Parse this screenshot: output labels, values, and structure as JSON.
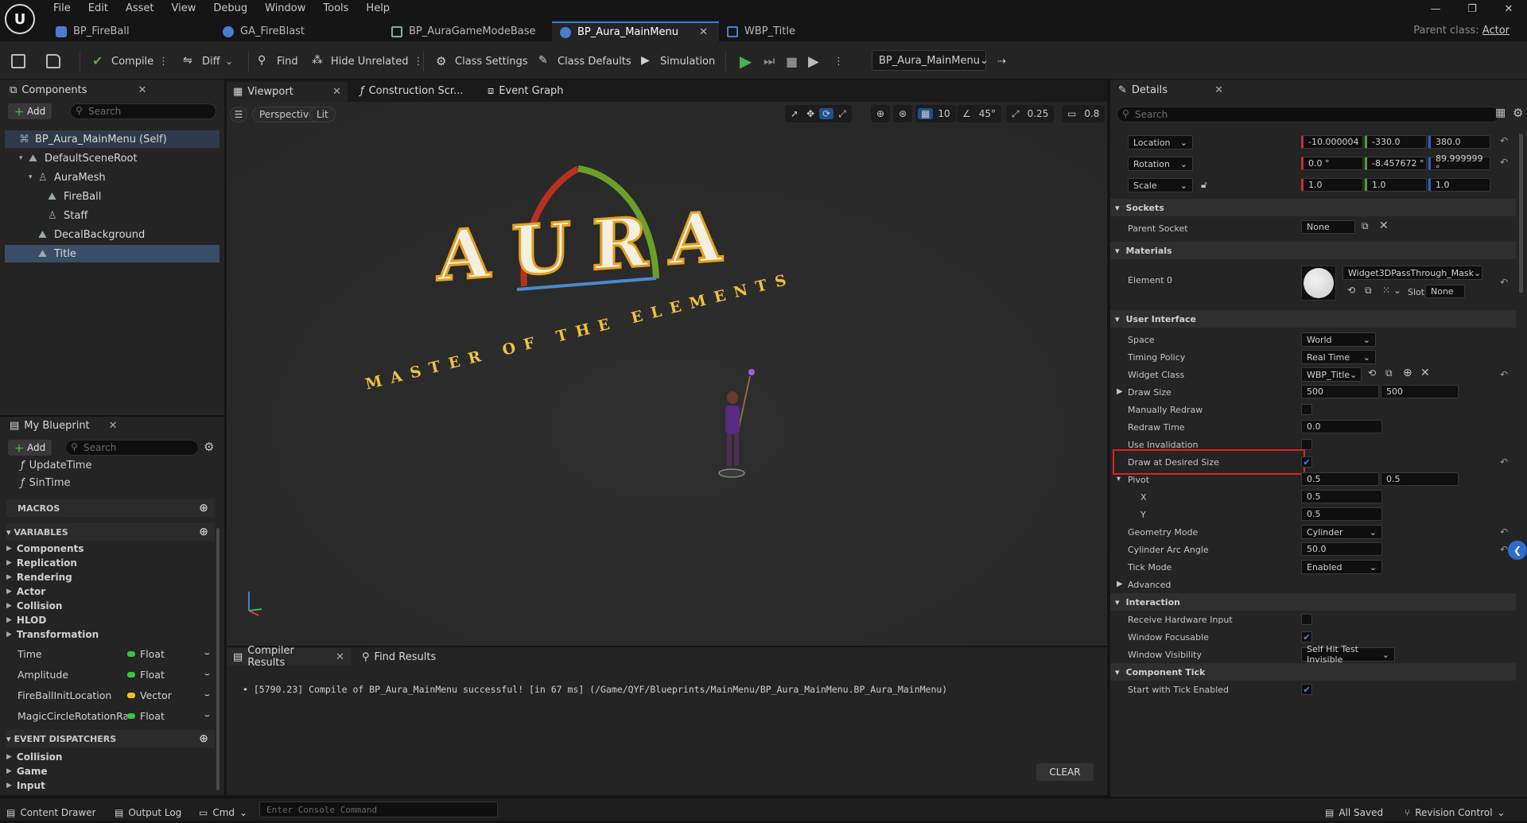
{
  "menu": [
    "File",
    "Edit",
    "Asset",
    "View",
    "Debug",
    "Window",
    "Tools",
    "Help"
  ],
  "file_tabs": [
    {
      "label": "BP_FireBall",
      "active": false
    },
    {
      "label": "GA_FireBlast",
      "active": false
    },
    {
      "label": "BP_AuraGameModeBase",
      "active": false
    },
    {
      "label": "BP_Aura_MainMenu",
      "active": true
    },
    {
      "label": "WBP_Title",
      "active": false
    }
  ],
  "parent_class": {
    "label": "Parent class:",
    "value": "Actor"
  },
  "toolbar": {
    "compile": "Compile",
    "diff": "Diff",
    "find": "Find",
    "hide_unrelated": "Hide Unrelated",
    "class_settings": "Class Settings",
    "class_defaults": "Class Defaults",
    "simulation": "Simulation",
    "debug_object": "BP_Aura_MainMenu"
  },
  "components": {
    "tab": "Components",
    "add": "Add",
    "search_placeholder": "Search",
    "tree": [
      {
        "label": "BP_Aura_MainMenu (Self)",
        "indent": 0,
        "state": "root"
      },
      {
        "label": "DefaultSceneRoot",
        "indent": 1,
        "state": ""
      },
      {
        "label": "AuraMesh",
        "indent": 2,
        "state": ""
      },
      {
        "label": "FireBall",
        "indent": 3,
        "state": ""
      },
      {
        "label": "Staff",
        "indent": 3,
        "state": ""
      },
      {
        "label": "DecalBackground",
        "indent": 2,
        "state": ""
      },
      {
        "label": "Title",
        "indent": 2,
        "state": "sel"
      }
    ]
  },
  "my_blueprint": {
    "tab": "My Blueprint",
    "add": "Add",
    "search_placeholder": "Search",
    "functions": [
      "UpdateTime",
      "SinTime"
    ],
    "macros": "MACROS",
    "variables": "VARIABLES",
    "categories": [
      "Components",
      "Replication",
      "Rendering",
      "Actor",
      "Collision",
      "HLOD",
      "Transformation"
    ],
    "vars": [
      {
        "name": "Time",
        "type": "Float",
        "color": "#35c83c"
      },
      {
        "name": "Amplitude",
        "type": "Float",
        "color": "#35c83c"
      },
      {
        "name": "FireBallInitLocation",
        "type": "Vector",
        "color": "#f0c020"
      },
      {
        "name": "MagicCircleRotationRa",
        "type": "Float",
        "color": "#35c83c"
      }
    ],
    "event_dispatchers": "EVENT DISPATCHERS",
    "ed_categories": [
      "Collision",
      "Game",
      "Input"
    ]
  },
  "editor_tabs": [
    "Viewport",
    "Construction Scr...",
    "Event Graph"
  ],
  "viewport": {
    "perspective": "Perspective",
    "lit": "Lit",
    "grid": "10",
    "angle": "45°",
    "scale": "0.25",
    "cam": "0.8",
    "title_text": "AURA",
    "subtitle": "MASTER OF THE ELEMENTS"
  },
  "compiler": {
    "tab": "Compiler Results",
    "find_tab": "Find Results",
    "message": "[5790.23] Compile of BP_Aura_MainMenu successful! [in 67 ms] (/Game/QYF/Blueprints/MainMenu/BP_Aura_MainMenu.BP_Aura_MainMenu)",
    "clear": "CLEAR"
  },
  "details": {
    "tab": "Details",
    "search_placeholder": "Search",
    "location": {
      "label": "Location",
      "x": "-10.000004",
      "y": "-330.0",
      "z": "380.0"
    },
    "rotation": {
      "label": "Rotation",
      "x": "0.0 °",
      "y": "-8.457672 °",
      "z": "89.999999 °"
    },
    "scale": {
      "label": "Scale",
      "x": "1.0",
      "y": "1.0",
      "z": "1.0"
    },
    "sockets": "Sockets",
    "parent_socket": "Parent Socket",
    "parent_socket_val": "None",
    "materials": "Materials",
    "element0": "Element 0",
    "material_val": "Widget3DPassThrough_Mask",
    "slot": "Slot",
    "slot_val": "None",
    "user_interface": "User Interface",
    "space": "Space",
    "space_val": "World",
    "timing": "Timing Policy",
    "timing_val": "Real Time",
    "widget_class": "Widget Class",
    "widget_class_val": "WBP_Title",
    "draw_size": "Draw Size",
    "draw_size_x": "500",
    "draw_size_y": "500",
    "manual_redraw": "Manually Redraw",
    "redraw_time": "Redraw Time",
    "redraw_time_val": "0.0",
    "use_invalidation": "Use Invalidation",
    "draw_desired": "Draw at Desired Size",
    "pivot": "Pivot",
    "pivot_x": "0.5",
    "pivot_y": "0.5",
    "x": "X",
    "y": "Y",
    "geometry": "Geometry Mode",
    "geometry_val": "Cylinder",
    "arc": "Cylinder Arc Angle",
    "arc_val": "50.0",
    "tick_mode": "Tick Mode",
    "tick_mode_val": "Enabled",
    "advanced": "Advanced",
    "interaction": "Interaction",
    "receive_hw": "Receive Hardware Input",
    "window_focusable": "Window Focusable",
    "window_visibility": "Window Visibility",
    "window_visibility_val": "Self Hit Test Invisible",
    "component_tick": "Component Tick",
    "start_tick": "Start with Tick Enabled"
  },
  "statusbar": {
    "content_drawer": "Content Drawer",
    "output_log": "Output Log",
    "cmd": "Cmd",
    "console_placeholder": "Enter Console Command",
    "all_saved": "All Saved",
    "revision": "Revision Control"
  },
  "colors": {
    "accent": "#3d8bfd",
    "selection": "#3b4c66",
    "highlight_box": "#e02020",
    "play": "#4caf50"
  }
}
